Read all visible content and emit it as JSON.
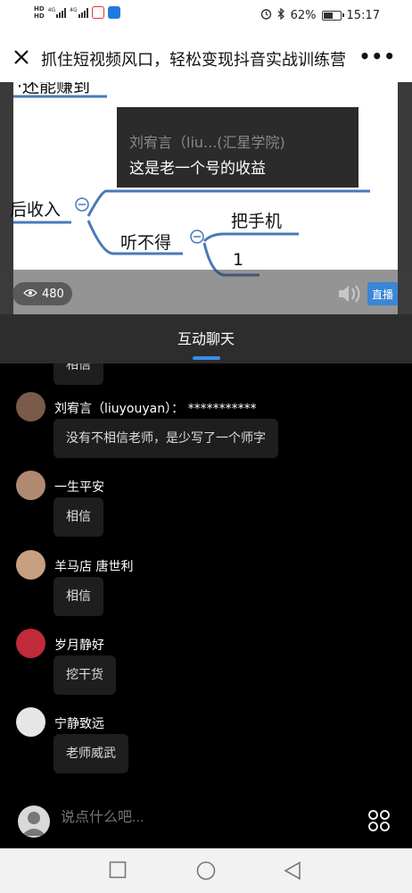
{
  "status": {
    "carrier1": "4G",
    "carrier2": "4G",
    "battery": "62%",
    "battery_level": 0.62,
    "time": "15:17"
  },
  "header": {
    "title": "抓住短视频风口，轻松变现抖音实战训练营",
    "more": "•••"
  },
  "video": {
    "slide_top_text": "·还能赚到",
    "slide_left_text": "后收入",
    "slide_mid_text": "听不得",
    "slide_node1": "把手机",
    "slide_node2": "1",
    "tooltip_name": "刘宥言（liu...(汇星学院)",
    "tooltip_msg": "这是老一个号的收益",
    "views": "480",
    "live_label": "直播"
  },
  "tabs": {
    "chat_label": "互动聊天"
  },
  "chat": {
    "partial_bubble": "相信",
    "messages": [
      {
        "user": "刘宥言（liuyouyan）： ***********",
        "text": "没有不相信老师，是少写了一个师字",
        "avatar_color": "#7a5a4a"
      },
      {
        "user": "一生平安",
        "text": "相信",
        "avatar_color": "#b08a70"
      },
      {
        "user": "羊马店 唐世利",
        "text": "相信",
        "avatar_color": "#c8a080"
      },
      {
        "user": "岁月静好",
        "text": "挖干货",
        "avatar_color": "#c02a3a"
      },
      {
        "user": "宁静致远",
        "text": "老师威武",
        "avatar_color": "#e6e6e6"
      }
    ]
  },
  "input": {
    "placeholder": "说点什么吧..."
  }
}
